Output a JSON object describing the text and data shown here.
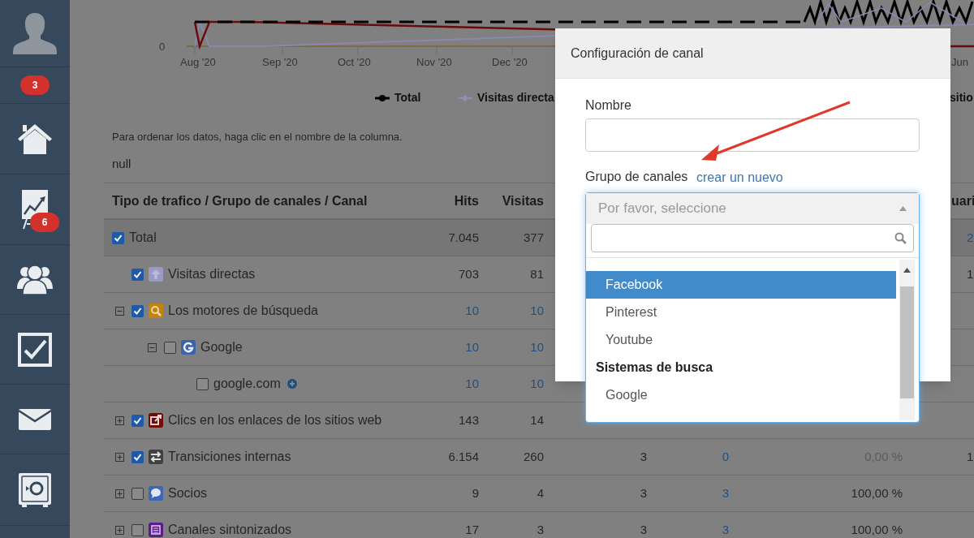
{
  "sidebar": {
    "items": [
      {
        "kind": "avatar"
      },
      {
        "kind": "badge",
        "badge": "3"
      },
      {
        "kind": "home"
      },
      {
        "kind": "reports",
        "badge": "6"
      },
      {
        "kind": "users"
      },
      {
        "kind": "tasks"
      },
      {
        "kind": "mail"
      },
      {
        "kind": "safe"
      }
    ]
  },
  "chart": {
    "y_tick": "0",
    "x_labels": [
      "Aug '20",
      "Sep '20",
      "Oct '20",
      "Nov '20",
      "Dec '20",
      "Jun"
    ],
    "legend": [
      {
        "name": "Total",
        "color": "#000000"
      },
      {
        "name": "Visitas directa",
        "color": "#8e8eb6"
      },
      {
        "name": "sitio"
      }
    ]
  },
  "note": "Para ordenar los datos, haga clic en el nombre de la columna.",
  "null_text": "null",
  "table": {
    "columns": {
      "name": "Tipo de trafico / Grupo de canales / Canal",
      "hits": "Hits",
      "visitas": "Visitas",
      "column_7": "uari"
    },
    "rows": [
      {
        "kind": "total",
        "label": "Total",
        "checked": true,
        "hits": {
          "text": "7.045",
          "link": false
        },
        "visitas": {
          "text": "377",
          "link": false
        },
        "column_7": {
          "text": "2",
          "link": true
        },
        "children": [
          {
            "kind": "direct",
            "color": "#9a9ac2",
            "label": "Visitas directas",
            "checked": true,
            "hits": {
              "text": "703",
              "link": false
            },
            "visitas": {
              "text": "81",
              "link": false
            },
            "column_7": {
              "text": "1",
              "link": false
            }
          },
          {
            "kind": "search",
            "color": "#c4820c",
            "label": "Los motores de búsqueda",
            "checked": true,
            "expanded": true,
            "hits": {
              "text": "10",
              "link": true
            },
            "visitas": {
              "text": "10",
              "link": true
            },
            "children": [
              {
                "kind": "google",
                "color": "#3d62ac",
                "label": "Google",
                "checked": false,
                "expanded": true,
                "hits": {
                  "text": "10",
                  "link": true
                },
                "visitas": {
                  "text": "10",
                  "link": true
                },
                "children": [
                  {
                    "kind": "domain",
                    "label": "google.com",
                    "checked": false,
                    "hits": {
                      "text": "10",
                      "link": true
                    },
                    "visitas": {
                      "text": "10",
                      "link": true
                    }
                  }
                ]
              }
            ]
          },
          {
            "kind": "link",
            "color": "#6e0c0c",
            "label": "Clics en los enlaces de los sitios web",
            "checked": true,
            "expanded": false,
            "hits": {
              "text": "143",
              "link": false
            },
            "visitas": {
              "text": "14",
              "link": false
            }
          },
          {
            "kind": "transfer",
            "color": "#404040",
            "label": "Transiciones internas",
            "checked": true,
            "expanded": false,
            "hits": {
              "text": "6.154",
              "link": false
            },
            "visitas": {
              "text": "260",
              "link": false
            },
            "column_4": {
              "text": "3",
              "link": false
            },
            "column_5": {
              "text": "0",
              "link": true
            },
            "column_6": {
              "text": "0,00 %",
              "link": false,
              "muted": true
            },
            "column_7": {
              "text": "1",
              "link": false
            }
          },
          {
            "kind": "chat",
            "color": "#3f66b6",
            "label": "Socios",
            "checked": false,
            "expanded": false,
            "hits": {
              "text": "9",
              "link": false
            },
            "visitas": {
              "text": "4",
              "link": false
            },
            "column_4": {
              "text": "3",
              "link": false
            },
            "column_5": {
              "text": "3",
              "link": true
            },
            "column_6": {
              "text": "100,00 %",
              "link": false,
              "muted": false
            }
          },
          {
            "kind": "list",
            "color": "#5c1a8c",
            "label": "Canales sintonizados",
            "checked": false,
            "expanded": false,
            "hits": {
              "text": "17",
              "link": false
            },
            "visitas": {
              "text": "3",
              "link": false
            },
            "column_4": {
              "text": "3",
              "link": false
            },
            "column_5": {
              "text": "3",
              "link": true
            },
            "column_6": {
              "text": "100,00 %",
              "link": false,
              "muted": false
            }
          }
        ]
      }
    ]
  },
  "modal": {
    "title": "Configuración de canal",
    "name_label": "Nombre",
    "group_label": "Grupo de canales",
    "group_link": "crear un nuevo",
    "select_placeholder": "Por favor, seleccione",
    "options": [
      {
        "kind": "option",
        "label": "Facebook",
        "selected": true
      },
      {
        "kind": "option",
        "label": "Pinterest",
        "selected": false
      },
      {
        "kind": "option",
        "label": "Youtube",
        "selected": false
      },
      {
        "kind": "group",
        "label": "Sistemas de busca"
      },
      {
        "kind": "option",
        "label": "Google",
        "selected": false
      }
    ]
  }
}
